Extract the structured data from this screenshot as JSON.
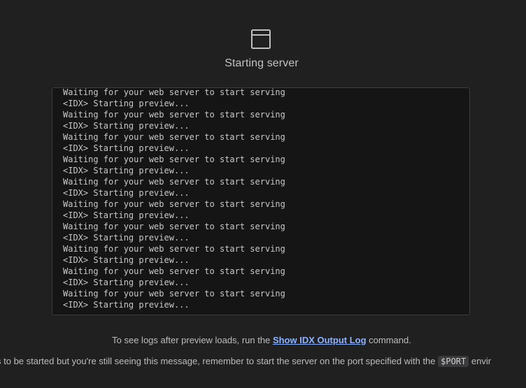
{
  "header": {
    "icon": "browser-window-icon",
    "title": "Starting server"
  },
  "log": {
    "lines": [
      "Waiting for your web server to start serving",
      "<IDX> Starting preview...",
      "Waiting for your web server to start serving",
      "<IDX> Starting preview...",
      "Waiting for your web server to start serving",
      "<IDX> Starting preview...",
      "Waiting for your web server to start serving",
      "<IDX> Starting preview...",
      "Waiting for your web server to start serving",
      "<IDX> Starting preview...",
      "Waiting for your web server to start serving",
      "<IDX> Starting preview...",
      "Waiting for your web server to start serving",
      "<IDX> Starting preview...",
      "Waiting for your web server to start serving",
      "<IDX> Starting preview...",
      "Waiting for your web server to start serving",
      "<IDX> Starting preview...",
      "Waiting for your web server to start serving",
      "<IDX> Starting preview..."
    ]
  },
  "hint": {
    "prefix": "To see logs after preview loads, run the ",
    "link": "Show IDX Output Log",
    "suffix": " command."
  },
  "note": {
    "prefix": "s to be started but you're still seeing this message, remember to start the server on the port specified with the ",
    "code": "$PORT",
    "suffix": " envir"
  },
  "colors": {
    "background": "#202021",
    "log_background": "#151516",
    "link": "#8cb4ff"
  }
}
